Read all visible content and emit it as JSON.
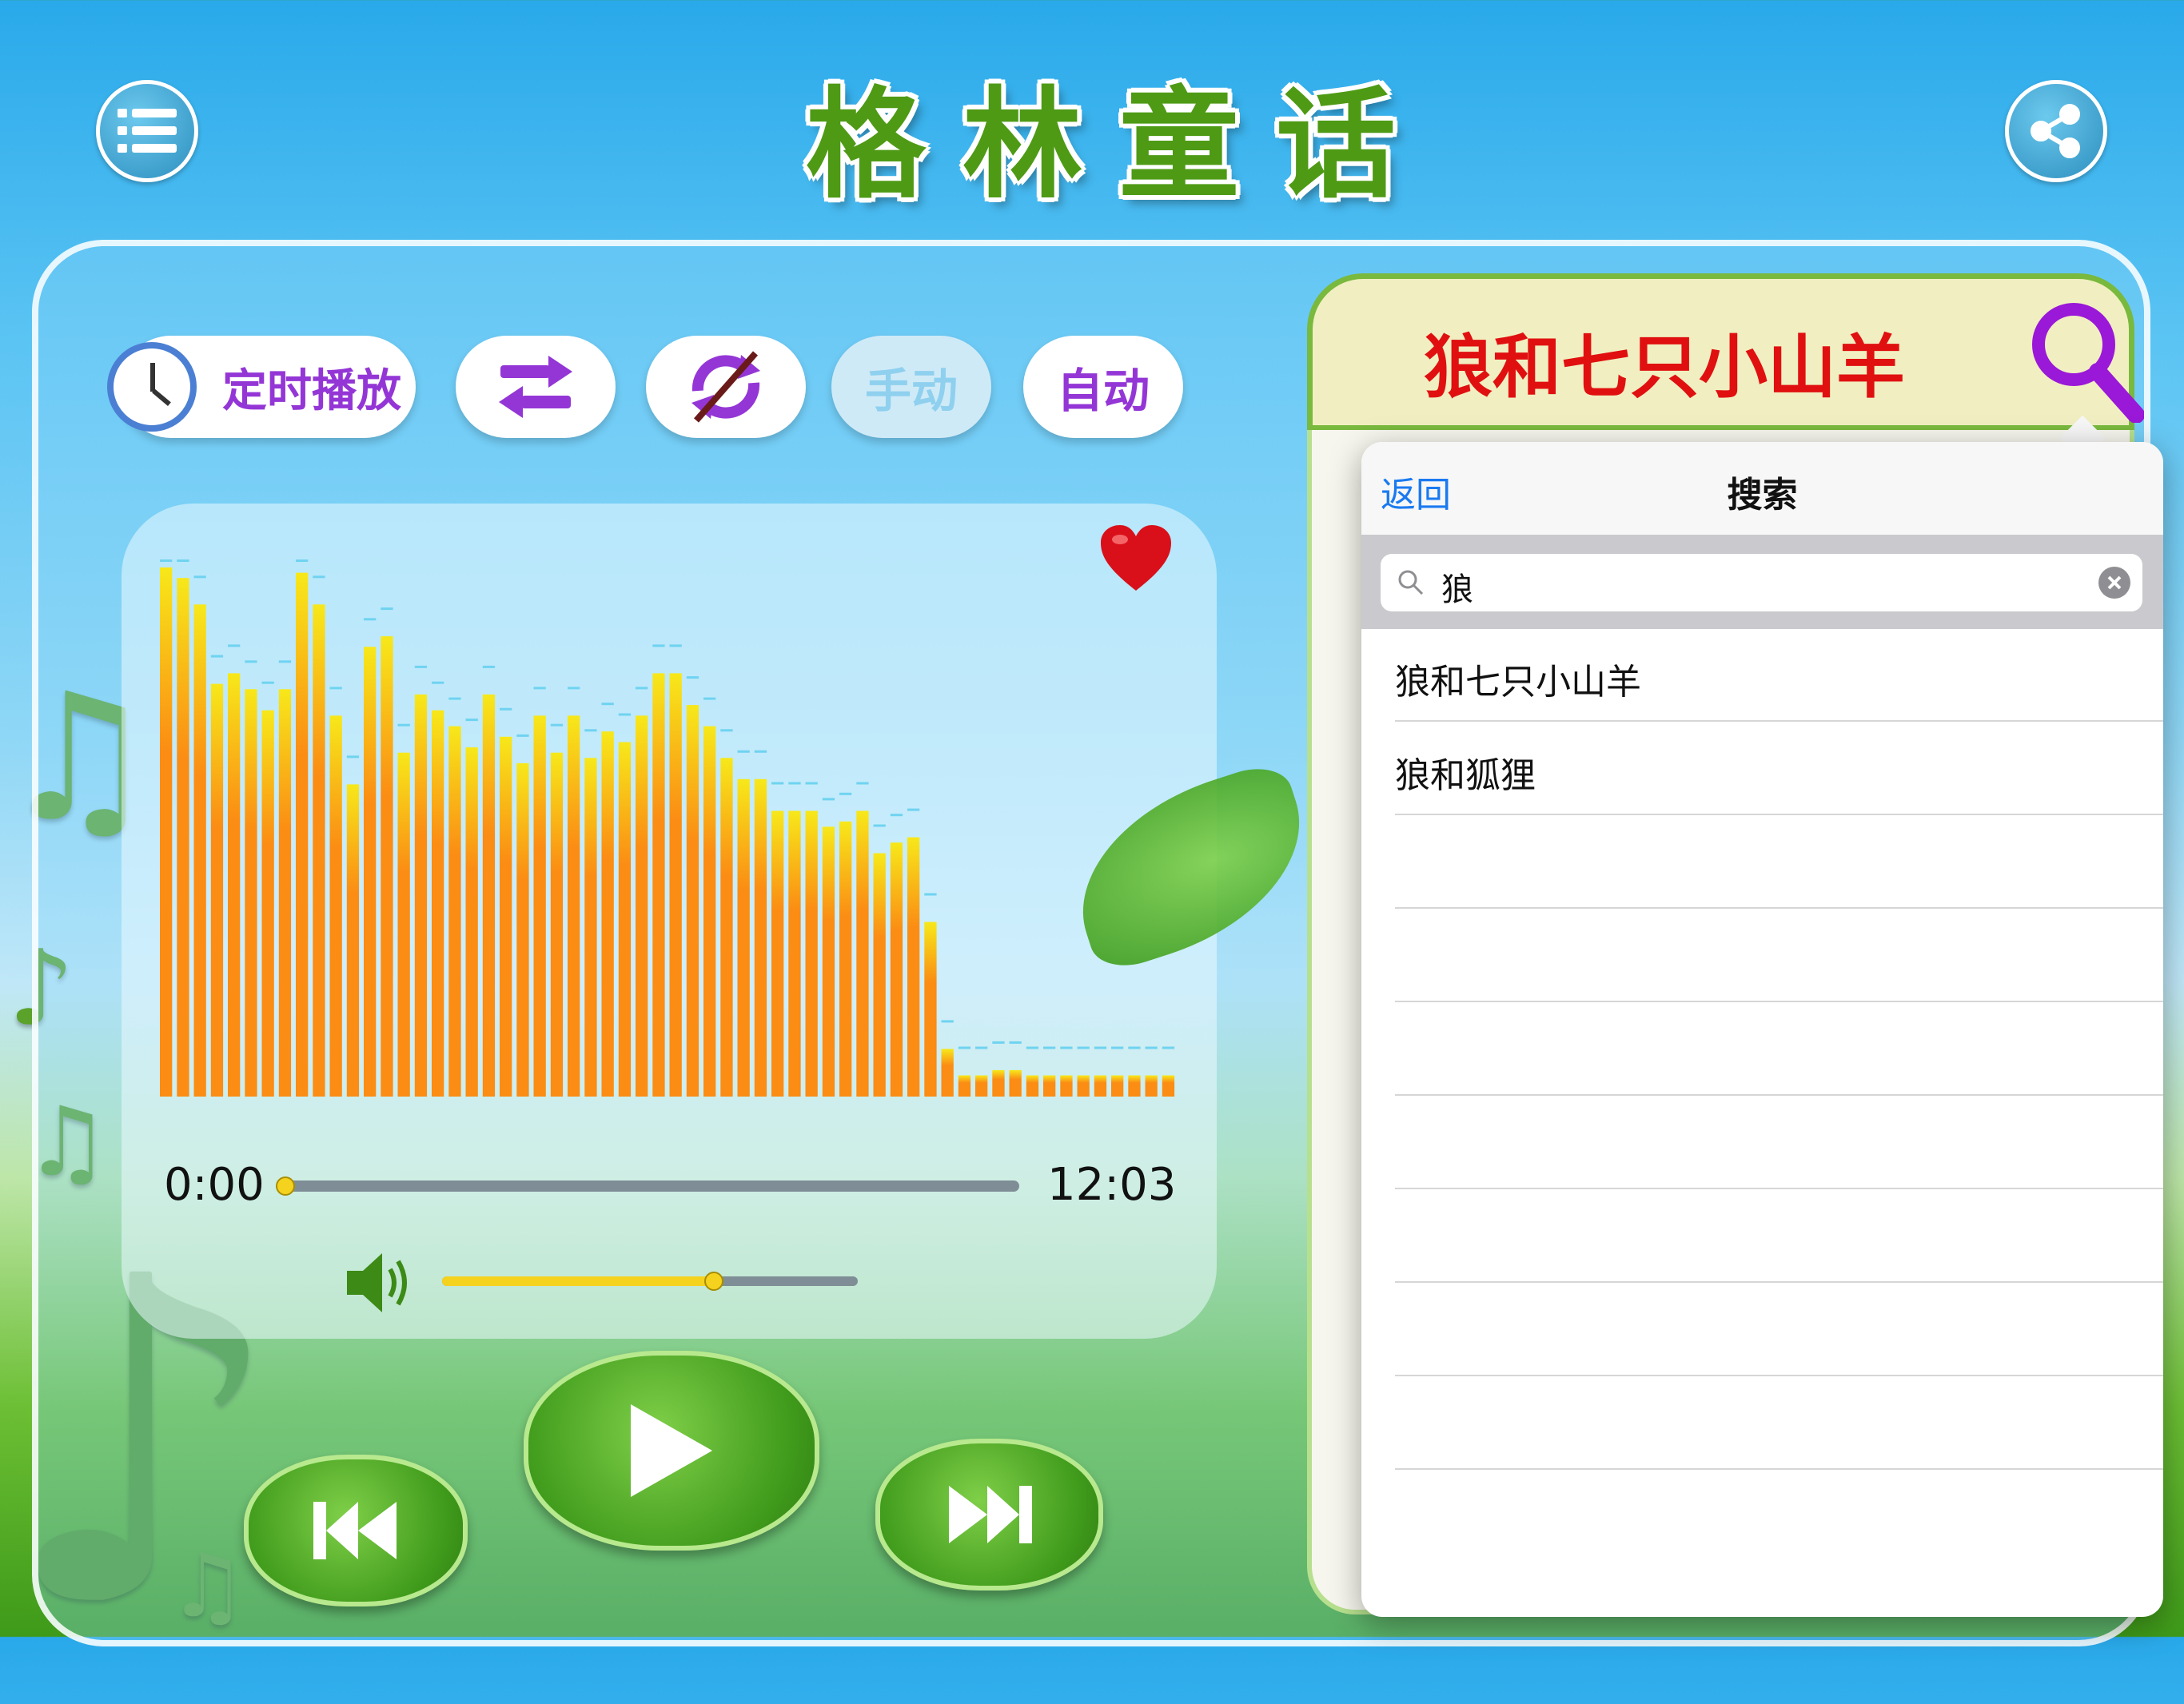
{
  "app": {
    "title_chars": [
      "格",
      "林",
      "童",
      "话"
    ]
  },
  "header": {
    "menu_icon": "list-icon",
    "share_icon": "share-icon"
  },
  "controls": {
    "timer_label": "定时播放",
    "shuffle_icon": "shuffle-icon",
    "repeat_off_icon": "repeat-off-icon",
    "manual_label": "手动",
    "auto_label": "自动"
  },
  "player": {
    "current_time": "0:00",
    "total_time": "12:03",
    "progress": 0.0,
    "volume": 0.65,
    "favorite_icon": "heart-icon",
    "spectrum_levels": [
      1.0,
      0.98,
      0.93,
      0.78,
      0.8,
      0.77,
      0.73,
      0.77,
      0.99,
      0.93,
      0.72,
      0.59,
      0.85,
      0.87,
      0.65,
      0.76,
      0.73,
      0.7,
      0.66,
      0.76,
      0.68,
      0.63,
      0.72,
      0.65,
      0.72,
      0.64,
      0.69,
      0.67,
      0.72,
      0.8,
      0.8,
      0.74,
      0.7,
      0.64,
      0.6,
      0.6,
      0.54,
      0.54,
      0.54,
      0.51,
      0.52,
      0.54,
      0.46,
      0.48,
      0.49,
      0.33,
      0.09,
      0.04,
      0.04,
      0.05,
      0.05,
      0.04,
      0.04,
      0.04,
      0.04,
      0.04,
      0.04,
      0.04,
      0.04,
      0.04
    ],
    "prev_icon": "previous-icon",
    "play_icon": "play-icon",
    "next_icon": "next-icon"
  },
  "now_playing": {
    "title": "狼和七只小山羊",
    "search_icon": "search-icon"
  },
  "search_popover": {
    "back_label": "返回",
    "title": "搜索",
    "query": "狼",
    "results": [
      "狼和七只小山羊",
      "狼和狐狸",
      "",
      "",
      "",
      "",
      "",
      "",
      ""
    ]
  },
  "colors": {
    "title_green": "#4e9a15",
    "accent_purple": "#9436d6",
    "song_red": "#e01010",
    "ios_blue": "#1a7af0",
    "bar_yellow": "#f7e81a",
    "bar_orange": "#fb8c14"
  }
}
